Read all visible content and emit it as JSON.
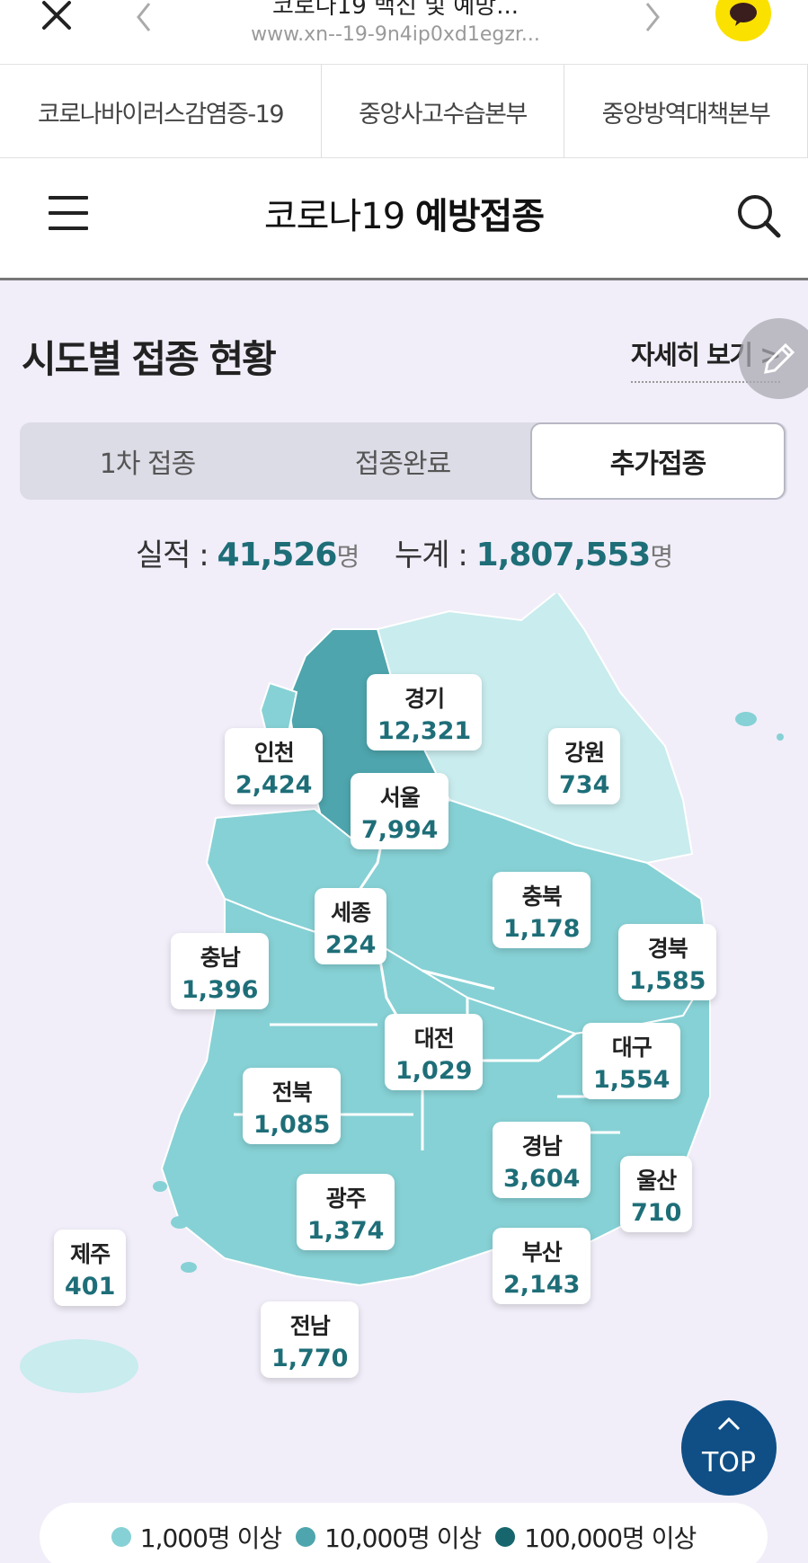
{
  "browser": {
    "title": "코로나19 백신 및 예방...",
    "url": "www.xn--19-9n4ip0xd1egzr..."
  },
  "org_tabs": [
    {
      "label": "코로나바이러스감염증-19"
    },
    {
      "label": "중앙사고수습본부"
    },
    {
      "label": "중앙방역대책본부"
    }
  ],
  "header": {
    "logo_part1": "코로나19",
    "logo_part2": "예방접종"
  },
  "section": {
    "title": "시도별 접종 현황",
    "more_label": "자세히 보기 >"
  },
  "tabs": [
    {
      "label": "1차 접종",
      "active": false
    },
    {
      "label": "접종완료",
      "active": false
    },
    {
      "label": "추가접종",
      "active": true
    }
  ],
  "totals": {
    "daily_label": "실적 :",
    "daily_value": "41,526",
    "daily_unit": "명",
    "cumulative_label": "누계 :",
    "cumulative_value": "1,807,553",
    "cumulative_unit": "명"
  },
  "regions": [
    {
      "name": "경기",
      "value": "12,321"
    },
    {
      "name": "인천",
      "value": "2,424"
    },
    {
      "name": "서울",
      "value": "7,994"
    },
    {
      "name": "강원",
      "value": "734"
    },
    {
      "name": "충북",
      "value": "1,178"
    },
    {
      "name": "세종",
      "value": "224"
    },
    {
      "name": "충남",
      "value": "1,396"
    },
    {
      "name": "경북",
      "value": "1,585"
    },
    {
      "name": "대전",
      "value": "1,029"
    },
    {
      "name": "대구",
      "value": "1,554"
    },
    {
      "name": "전북",
      "value": "1,085"
    },
    {
      "name": "경남",
      "value": "3,604"
    },
    {
      "name": "울산",
      "value": "710"
    },
    {
      "name": "광주",
      "value": "1,374"
    },
    {
      "name": "부산",
      "value": "2,143"
    },
    {
      "name": "제주",
      "value": "401"
    },
    {
      "name": "전남",
      "value": "1,770"
    }
  ],
  "top_button": {
    "label": "TOP"
  },
  "legend": [
    {
      "label": "1,000명 이상",
      "color": "#86d1d5"
    },
    {
      "label": "10,000명 이상",
      "color": "#4ea5ad"
    },
    {
      "label": "100,000명 이상",
      "color": "#17666e"
    }
  ],
  "colors": {
    "tier_low": "#c9ecee",
    "tier_1k": "#86d1d5",
    "tier_10k": "#4ea5ad",
    "accent_number": "#1e6e78",
    "top_button": "#0f4f86",
    "kakao": "#fae100"
  }
}
